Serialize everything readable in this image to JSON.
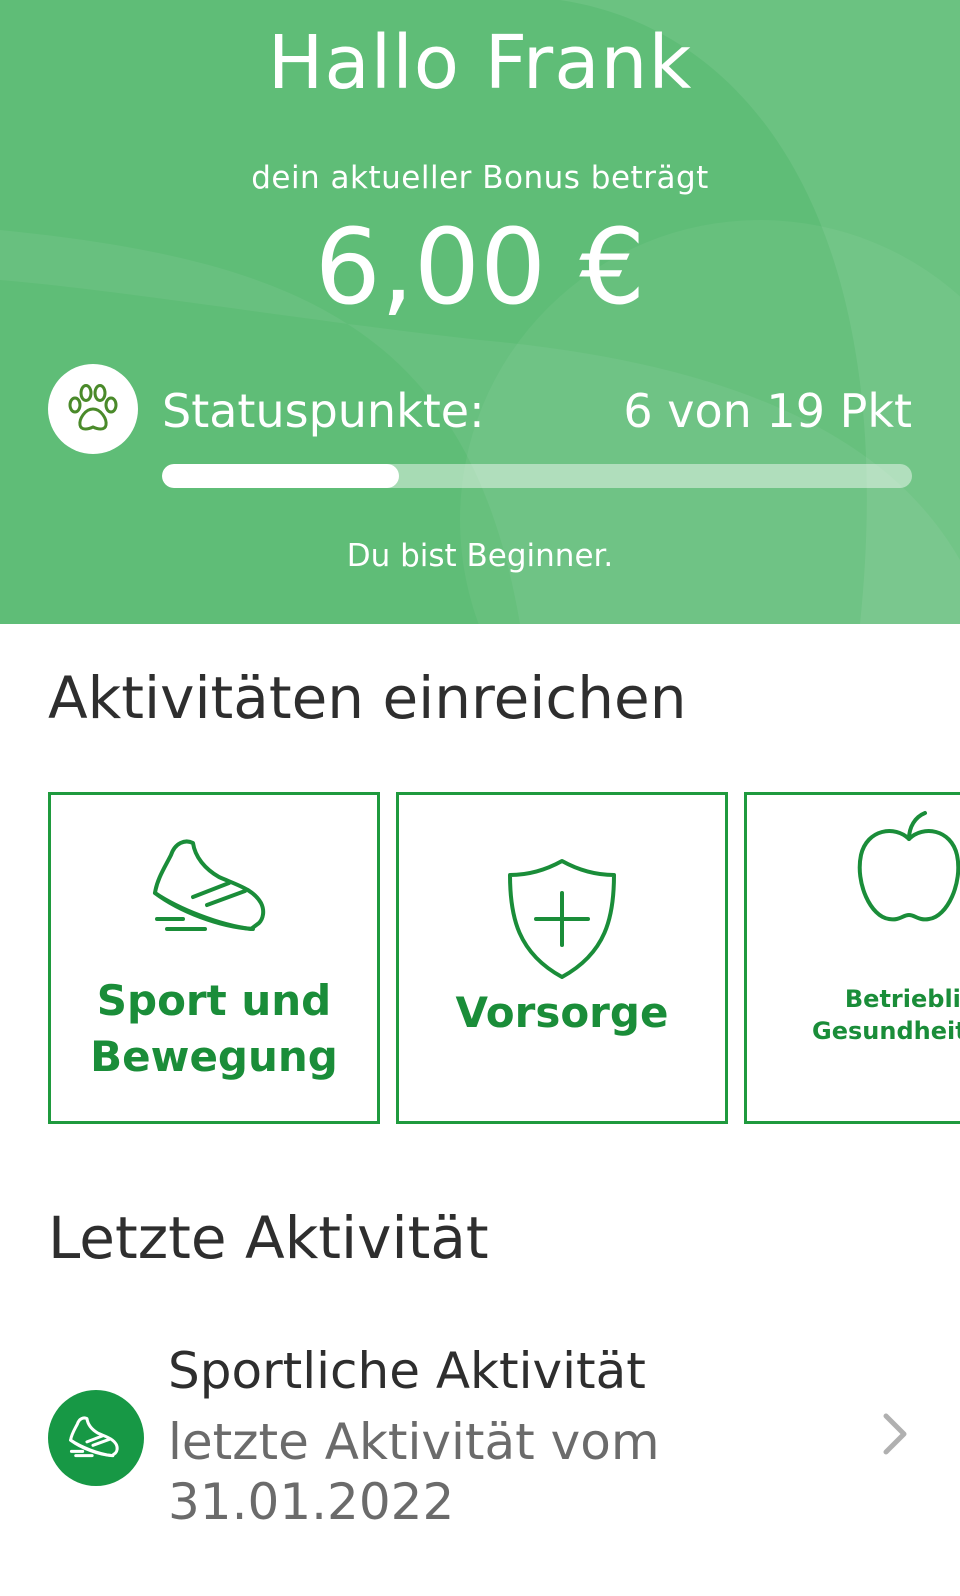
{
  "header": {
    "greeting": "Hallo Frank",
    "bonus_label": "dein aktueller Bonus beträgt",
    "bonus_value": "6,00 €",
    "status_label": "Statuspunkte:",
    "status_value": "6 von 19 Pkt",
    "status_progress": 0.316,
    "level_text": "Du bist Beginner.",
    "icon": "paw-icon"
  },
  "submit_section": {
    "title": "Aktivitäten einreichen",
    "tiles": [
      {
        "label_line1": "Sport und",
        "label_line2": "Bewegung",
        "icon": "sneaker-icon"
      },
      {
        "label": "Vorsorge",
        "icon": "shield-plus-icon"
      },
      {
        "label_line1": "Betrieblic",
        "label_line2": "Gesundheitsfö",
        "icon": "apple-icon"
      }
    ]
  },
  "last_activity": {
    "title": "Letzte Aktivität",
    "item": {
      "name": "Sportliche Aktivität",
      "subtitle": "letzte Aktivität vom 31.01.2022",
      "icon": "sneaker-icon"
    }
  },
  "colors": {
    "hero_green": "#5fbd77",
    "brand_green": "#1a8d39",
    "circle_green": "#179845"
  }
}
